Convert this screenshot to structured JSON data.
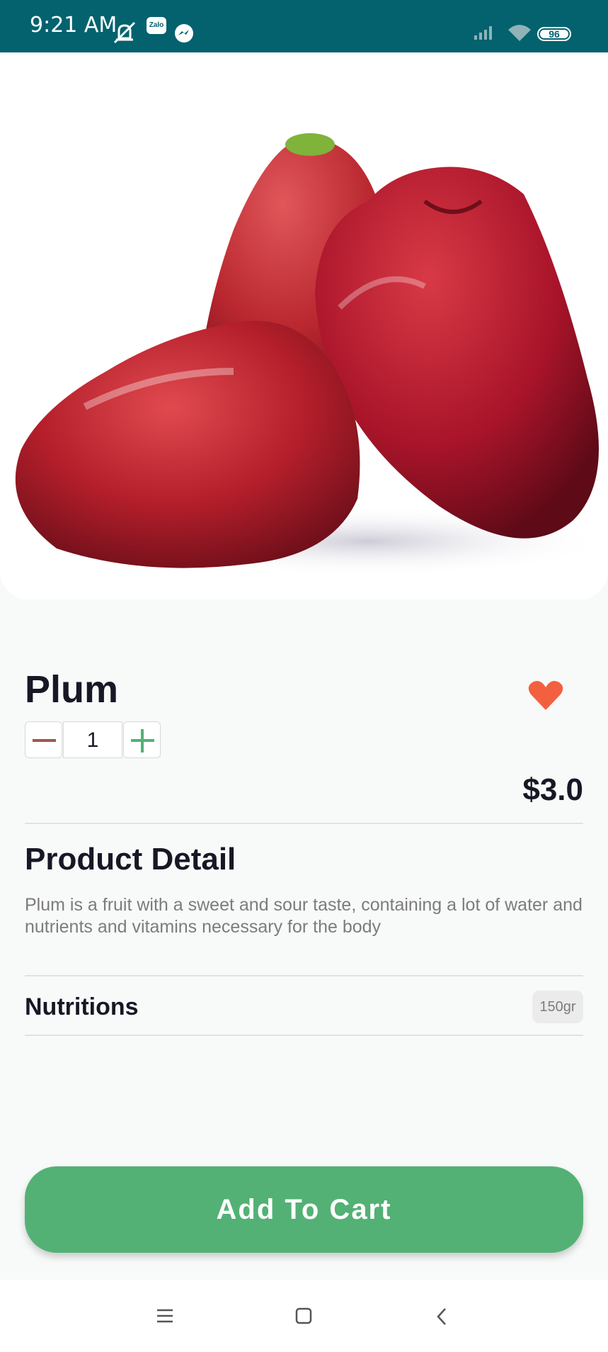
{
  "status_bar": {
    "time": "9:21 AM",
    "app_icons": [
      "mute-icon",
      "zalo-icon",
      "messenger-icon"
    ],
    "zalo_text": "Zalo",
    "battery": "96",
    "color": "#03626e"
  },
  "product": {
    "name": "Plum",
    "quantity": "1",
    "price": "$3.0",
    "favorite": true
  },
  "detail": {
    "title": "Product Detail",
    "description": "Plum is a fruit with a sweet and sour taste, containing a lot of water and nutrients and vitamins necessary for the body"
  },
  "nutritions": {
    "label": "Nutritions",
    "value": "150gr"
  },
  "cart_button": {
    "label": "Add To Cart",
    "color": "#53b175"
  },
  "nav": {
    "icons": [
      "menu-icon",
      "home-icon",
      "back-icon"
    ]
  },
  "colors": {
    "accent": "#53b175",
    "heart": "#f3603f",
    "text": "#181725",
    "muted": "#7c7c7c"
  }
}
